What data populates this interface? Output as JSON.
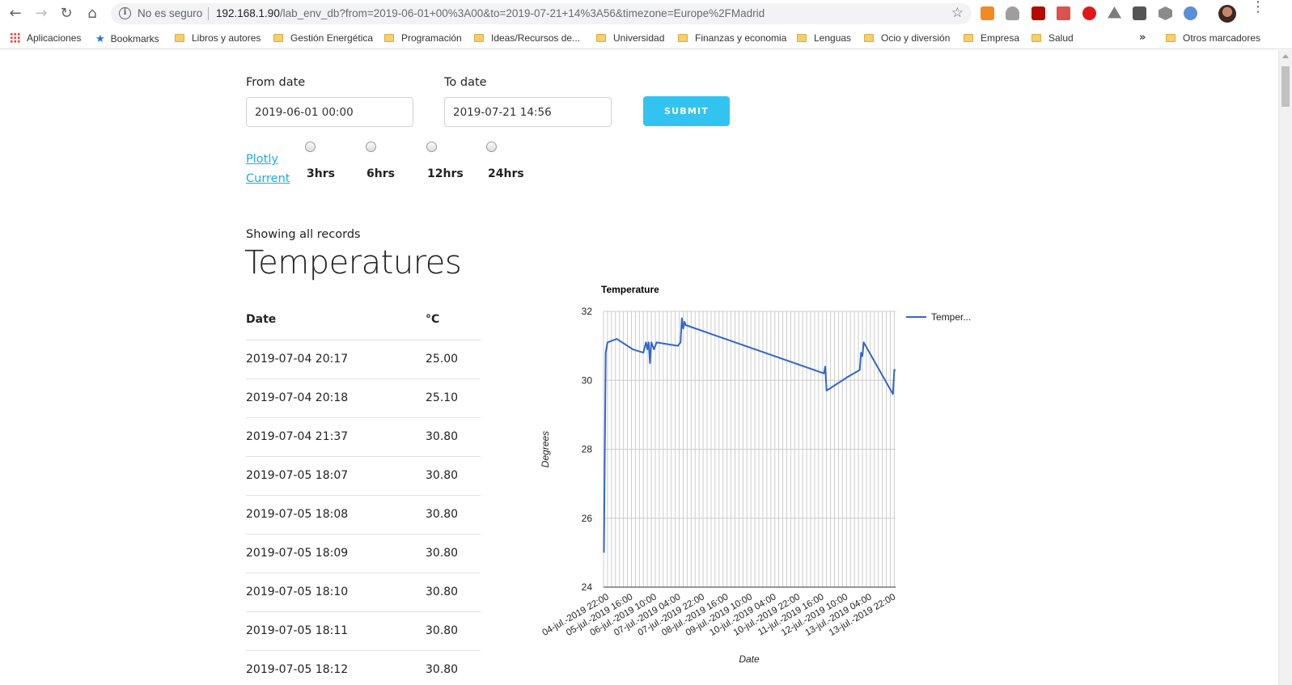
{
  "browser": {
    "security_label": "No es seguro",
    "url_host": "192.168.1.90",
    "url_path": "/lab_env_db?from=2019-06-01+00%3A00&to=2019-07-21+14%3A56&timezone=Europe%2FMadrid",
    "bookmarks": [
      {
        "label": "Aplicaciones",
        "icon": "apps-grid-icon"
      },
      {
        "label": "Bookmarks",
        "icon": "star-icon"
      },
      {
        "label": "Libros y autores",
        "icon": "folder-icon"
      },
      {
        "label": "Gestión Energética",
        "icon": "folder-icon"
      },
      {
        "label": "Programación",
        "icon": "folder-icon"
      },
      {
        "label": "Ideas/Recursos de...",
        "icon": "folder-icon"
      },
      {
        "label": "Universidad",
        "icon": "folder-icon"
      },
      {
        "label": "Finanzas y economia",
        "icon": "folder-icon"
      },
      {
        "label": "Lenguas",
        "icon": "folder-icon"
      },
      {
        "label": "Ocio y diversión",
        "icon": "folder-icon"
      },
      {
        "label": "Empresa",
        "icon": "folder-icon"
      },
      {
        "label": "Salud",
        "icon": "folder-icon"
      }
    ],
    "overflow_glyph": "»",
    "other_bookmarks": "Otros marcadores"
  },
  "form": {
    "from_label": "From date",
    "from_value": "2019-06-01 00:00",
    "to_label": "To date",
    "to_value": "2019-07-21 14:56",
    "submit_label": "SUBMIT",
    "links": {
      "plotly": "Plotly",
      "current": "Current"
    },
    "ranges": [
      "3hrs",
      "6hrs",
      "12hrs",
      "24hrs"
    ]
  },
  "content": {
    "showing": "Showing all records",
    "heading": "Temperatures",
    "table": {
      "headers": [
        "Date",
        "°C"
      ],
      "rows": [
        [
          "2019-07-04 20:17",
          "25.00"
        ],
        [
          "2019-07-04 20:18",
          "25.10"
        ],
        [
          "2019-07-04 21:37",
          "30.80"
        ],
        [
          "2019-07-05 18:07",
          "30.80"
        ],
        [
          "2019-07-05 18:08",
          "30.80"
        ],
        [
          "2019-07-05 18:09",
          "30.80"
        ],
        [
          "2019-07-05 18:10",
          "30.80"
        ],
        [
          "2019-07-05 18:11",
          "30.80"
        ],
        [
          "2019-07-05 18:12",
          "30.80"
        ]
      ]
    }
  },
  "colors": {
    "accent": "#33c3f0",
    "link": "#1eaedb",
    "series": "#3366cc"
  },
  "chart_data": {
    "type": "line",
    "title": "Temperature",
    "xlabel": "Date",
    "ylabel": "Degrees",
    "ylim": [
      24,
      32
    ],
    "yticks": [
      24,
      26,
      28,
      30,
      32
    ],
    "x_tick_labels": [
      "04-jul.-2019 22:00",
      "05-jul.-2019 16:00",
      "06-jul.-2019 10:00",
      "07-jul.-2019 04:00",
      "07-jul.-2019 22:00",
      "08-jul.-2019 16:00",
      "09-jul.-2019 10:00",
      "10-jul.-2019 04:00",
      "10-jul.-2019 22:00",
      "11-jul.-2019 16:00",
      "12-jul.-2019 10:00",
      "13-jul.-2019 04:00",
      "13-jul.-2019 22:00"
    ],
    "xlim": [
      "2019-07-04 20:00",
      "2019-07-14 00:00"
    ],
    "grid": true,
    "legend": "right",
    "series": [
      {
        "name": "Temper...",
        "points": [
          [
            "2019-07-04 20:17",
            25.0
          ],
          [
            "2019-07-04 20:18",
            25.1
          ],
          [
            "2019-07-04 21:37",
            30.8
          ],
          [
            "2019-07-04 23:00",
            31.1
          ],
          [
            "2019-07-05 06:00",
            31.2
          ],
          [
            "2019-07-05 18:00",
            30.9
          ],
          [
            "2019-07-06 02:00",
            30.8
          ],
          [
            "2019-07-06 04:00",
            31.1
          ],
          [
            "2019-07-06 05:00",
            30.9
          ],
          [
            "2019-07-06 06:00",
            31.1
          ],
          [
            "2019-07-06 07:00",
            30.5
          ],
          [
            "2019-07-06 08:00",
            31.1
          ],
          [
            "2019-07-06 10:00",
            30.9
          ],
          [
            "2019-07-06 12:00",
            31.1
          ],
          [
            "2019-07-07 04:00",
            31.0
          ],
          [
            "2019-07-07 06:00",
            31.1
          ],
          [
            "2019-07-07 07:00",
            31.8
          ],
          [
            "2019-07-07 08:00",
            31.5
          ],
          [
            "2019-07-07 09:00",
            31.7
          ],
          [
            "2019-07-07 10:00",
            31.6
          ],
          [
            "2019-07-11 18:00",
            30.2
          ],
          [
            "2019-07-11 19:00",
            30.4
          ],
          [
            "2019-07-11 20:00",
            29.7
          ],
          [
            "2019-07-12 12:00",
            30.1
          ],
          [
            "2019-07-12 21:00",
            30.3
          ],
          [
            "2019-07-12 22:00",
            30.8
          ],
          [
            "2019-07-12 23:00",
            30.7
          ],
          [
            "2019-07-13 00:00",
            31.1
          ],
          [
            "2019-07-13 22:00",
            29.6
          ],
          [
            "2019-07-13 23:00",
            30.3
          ],
          [
            "2019-07-14 00:00",
            30.3
          ]
        ]
      }
    ]
  }
}
